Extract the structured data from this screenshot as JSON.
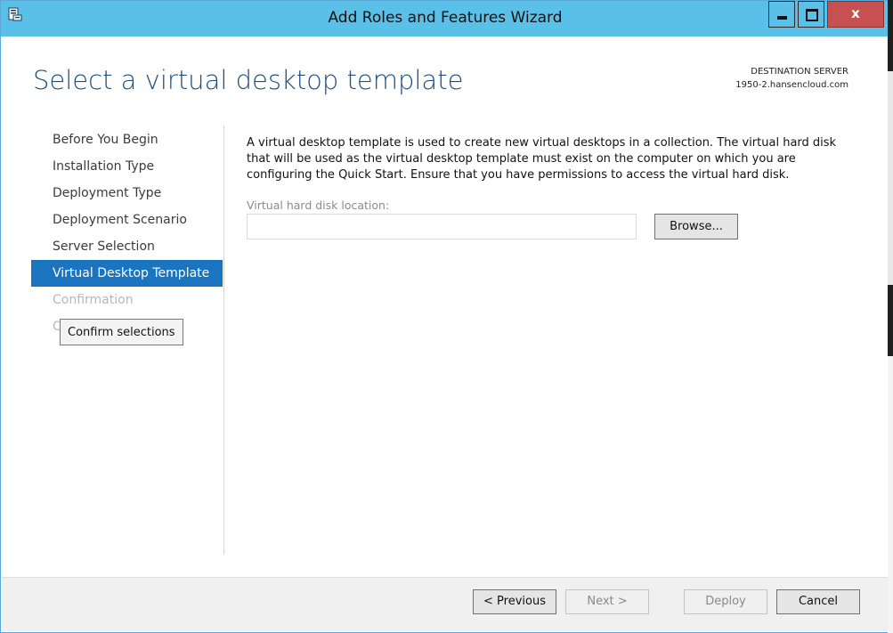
{
  "window": {
    "title": "Add Roles and Features Wizard",
    "close_glyph": "x",
    "icons": [
      "server-wizard-icon",
      "minimize-icon",
      "maximize-icon",
      "close-icon"
    ]
  },
  "header": {
    "page_title": "Select a virtual desktop template",
    "destination_label": "DESTINATION SERVER",
    "destination_server": "1950-2.hansencloud.com"
  },
  "nav": {
    "items": [
      {
        "label": "Before You Begin",
        "state": "normal"
      },
      {
        "label": "Installation Type",
        "state": "normal"
      },
      {
        "label": "Deployment Type",
        "state": "normal"
      },
      {
        "label": "Deployment Scenario",
        "state": "normal"
      },
      {
        "label": "Server Selection",
        "state": "normal"
      },
      {
        "label": "Virtual Desktop Template",
        "state": "active"
      },
      {
        "label": "Confirmation",
        "state": "disabled"
      },
      {
        "label": "C",
        "state": "disabled"
      }
    ],
    "tooltip": "Confirm selections"
  },
  "content": {
    "description": "A virtual desktop template is used to create new virtual desktops in a collection. The virtual hard disk that will be used as the virtual desktop template must exist on the computer on which you are configuring the Quick Start. Ensure that you have permissions to access the virtual hard disk.",
    "vhd_label": "Virtual hard disk location:",
    "vhd_value": "",
    "vhd_placeholder": "",
    "browse_label": "Browse..."
  },
  "footer": {
    "previous_label": "< Previous",
    "next_label": "Next >",
    "deploy_label": "Deploy",
    "cancel_label": "Cancel"
  },
  "colors": {
    "titlebar": "#5bc0e8",
    "close_button": "#c75050",
    "active_nav": "#1a74c0",
    "page_title": "#1e4f80"
  }
}
